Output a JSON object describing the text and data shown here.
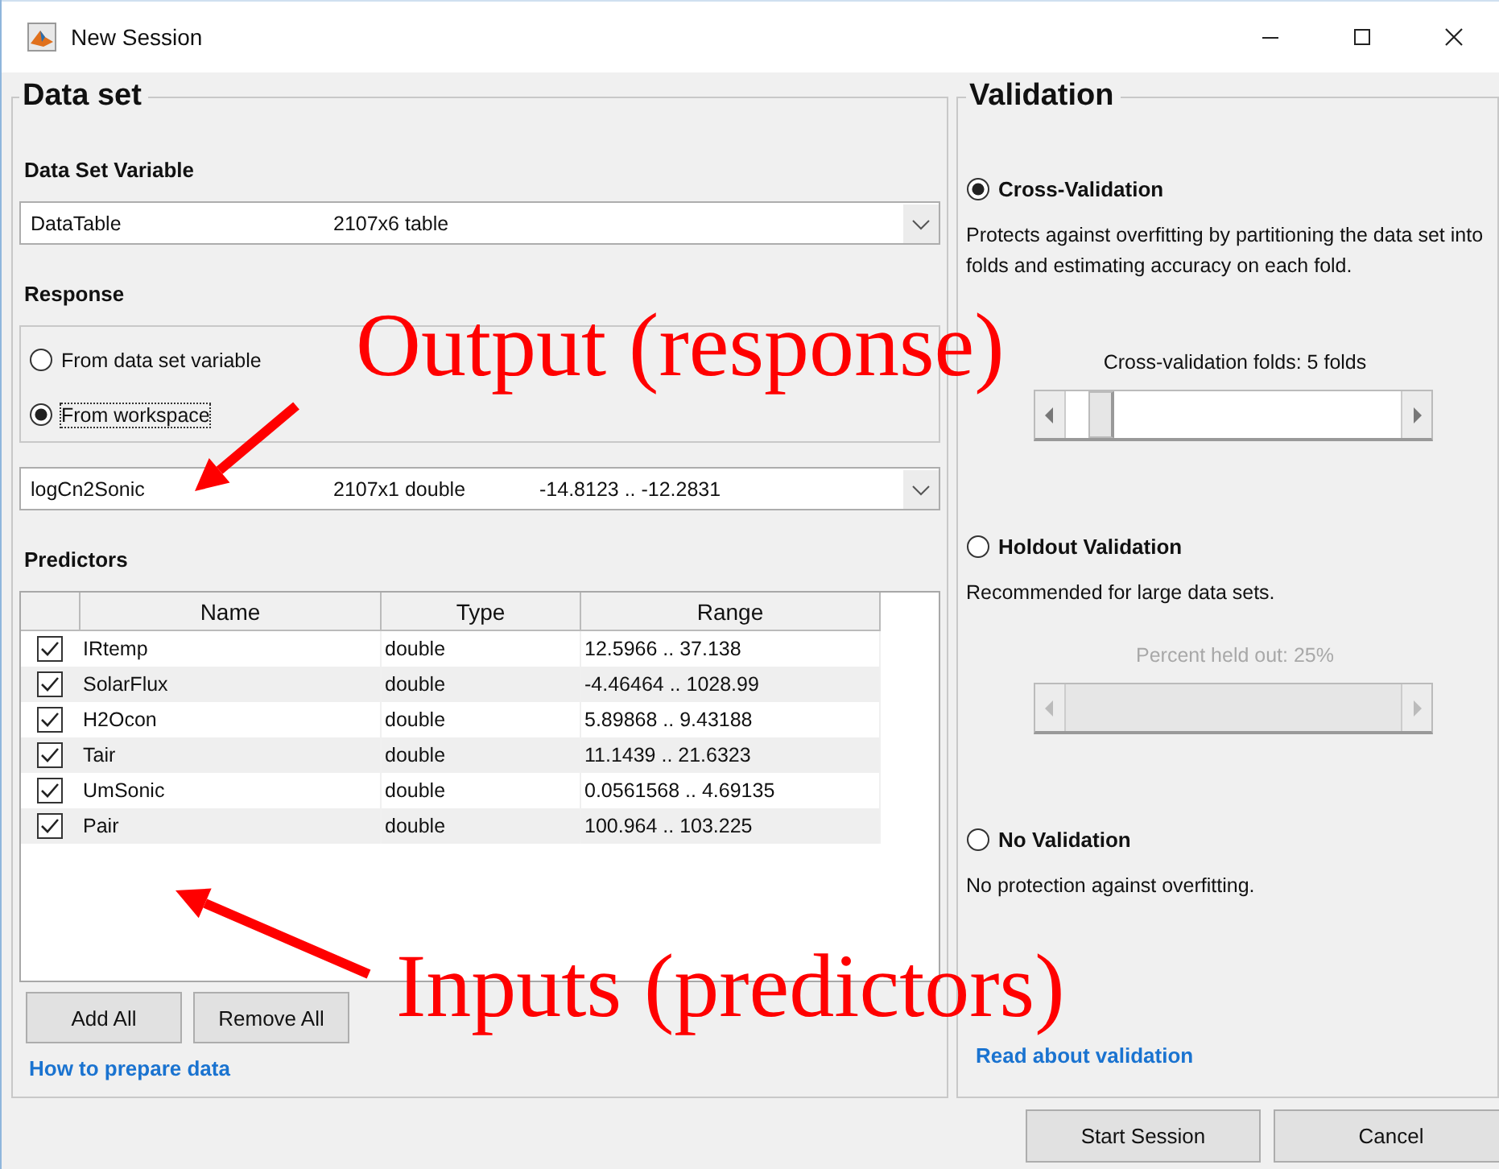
{
  "window": {
    "title": "New Session"
  },
  "data_set": {
    "title": "Data set",
    "variable_label": "Data Set Variable",
    "variable": {
      "name": "DataTable",
      "size": "2107x6 table"
    },
    "response_label": "Response",
    "response_options": [
      {
        "label": "From data set variable",
        "selected": false
      },
      {
        "label": "From workspace",
        "selected": true
      }
    ],
    "response_variable": {
      "name": "logCn2Sonic",
      "size": "2107x1 double",
      "range": "-14.8123 .. -12.2831"
    },
    "predictors_label": "Predictors",
    "table": {
      "columns": [
        "Name",
        "Type",
        "Range"
      ],
      "rows": [
        {
          "checked": true,
          "name": "IRtemp",
          "type": "double",
          "range": "12.5966 .. 37.138"
        },
        {
          "checked": true,
          "name": "SolarFlux",
          "type": "double",
          "range": "-4.46464 .. 1028.99"
        },
        {
          "checked": true,
          "name": "H2Ocon",
          "type": "double",
          "range": "5.89868 .. 9.43188"
        },
        {
          "checked": true,
          "name": "Tair",
          "type": "double",
          "range": "11.1439 .. 21.6323"
        },
        {
          "checked": true,
          "name": "UmSonic",
          "type": "double",
          "range": "0.0561568 .. 4.69135"
        },
        {
          "checked": true,
          "name": "Pair",
          "type": "double",
          "range": "100.964 .. 103.225"
        }
      ]
    },
    "buttons": [
      "Add All",
      "Remove All"
    ],
    "link": "How to prepare data"
  },
  "validation": {
    "title": "Validation",
    "options": [
      {
        "label": "Cross-Validation",
        "selected": true,
        "description": "Protects against overfitting by partitioning the data set into folds and estimating accuracy on each fold.",
        "slider": {
          "caption": "Cross-validation folds: 5 folds",
          "disabled": false
        }
      },
      {
        "label": "Holdout Validation",
        "selected": false,
        "description": "Recommended for large data sets.",
        "slider": {
          "caption": "Percent held out: 25%",
          "disabled": true
        }
      },
      {
        "label": "No Validation",
        "selected": false,
        "description": "No protection against overfitting."
      }
    ],
    "link": "Read about validation"
  },
  "buttons": [
    "Start Session",
    "Cancel"
  ],
  "annotations": [
    {
      "text": "Output (response)"
    },
    {
      "text": "Inputs (predictors)"
    }
  ]
}
